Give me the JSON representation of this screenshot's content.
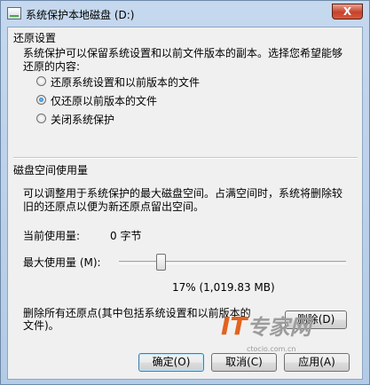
{
  "window": {
    "title": "系统保护本地磁盘 (D:)",
    "close_glyph": "X"
  },
  "restore": {
    "section_title": "还原设置",
    "description_line1": "系统保护可以保留系统设置和以前文件版本的副本。选择您希望能够",
    "description_line2": "还原的内容:",
    "options": [
      {
        "label": "还原系统设置和以前版本的文件",
        "selected": false
      },
      {
        "label": "仅还原以前版本的文件",
        "selected": true
      },
      {
        "label": "关闭系统保护",
        "selected": false
      }
    ]
  },
  "disk": {
    "section_title": "磁盘空间使用量",
    "description_line1": "可以调整用于系统保护的最大磁盘空间。占满空间时，系统将删除较",
    "description_line2": "旧的还原点以便为新还原点留出空间。",
    "current_usage_label": "当前使用量:",
    "current_usage_value": "0 字节",
    "max_usage_label": "最大使用量 (M):",
    "max_usage_percent": 17,
    "max_usage_readout": "17% (1,019.83 MB)"
  },
  "delete": {
    "description_line1": "删除所有还原点(其中包括系统设置和以前版本的",
    "description_line2": "文件)。",
    "button_label": "删除(D)"
  },
  "buttons": {
    "ok": "确定(O)",
    "cancel": "取消(C)",
    "apply": "应用(A)"
  },
  "watermark": {
    "brand_it": "IT",
    "brand_cn": "专家网",
    "url": "ctocio.com.cn"
  }
}
